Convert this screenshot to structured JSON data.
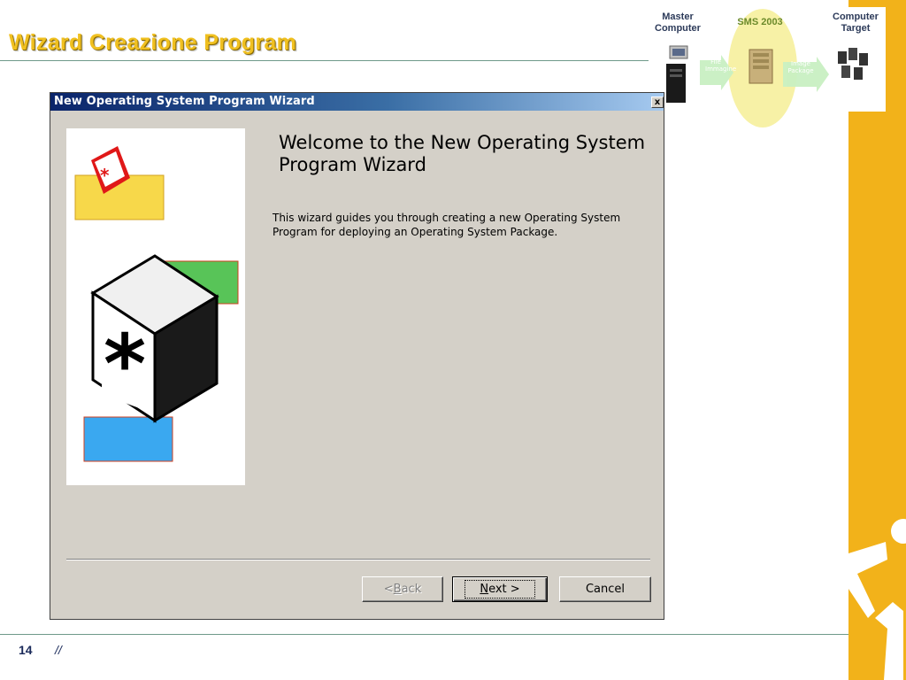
{
  "slide": {
    "title": "Wizard Creazione Program",
    "page_number": "14",
    "footer_separator": "//"
  },
  "flow": {
    "master_label": "Master Computer",
    "sms_label": "SMS 2003",
    "target_label": "Computer Target",
    "arrow1_text": "File Immagine",
    "arrow2_text": "Image Package",
    "icons": [
      "workstation-icon",
      "server-icon",
      "computer-group-icon"
    ],
    "colors": {
      "sms_highlight": "#f7f1a6",
      "arrow": "#c9f0c2"
    }
  },
  "wizard": {
    "window_title": "New Operating System Program Wizard",
    "close_glyph": "x",
    "heading": "Welcome to the New Operating System Program Wizard",
    "description": "This wizard guides you through creating a new Operating System Program for deploying an Operating System Package.",
    "buttons": {
      "back": {
        "prefix": "< ",
        "mnemonic": "B",
        "rest": "ack"
      },
      "next": {
        "mnemonic": "N",
        "rest": "ext >"
      },
      "cancel": "Cancel"
    },
    "colors": {
      "title_start": "#0a246a",
      "title_end": "#a6caf0",
      "face": "#d4d0c8"
    }
  },
  "theme": {
    "accent_yellow": "#f2b21a",
    "title_color": "#f0c020"
  }
}
